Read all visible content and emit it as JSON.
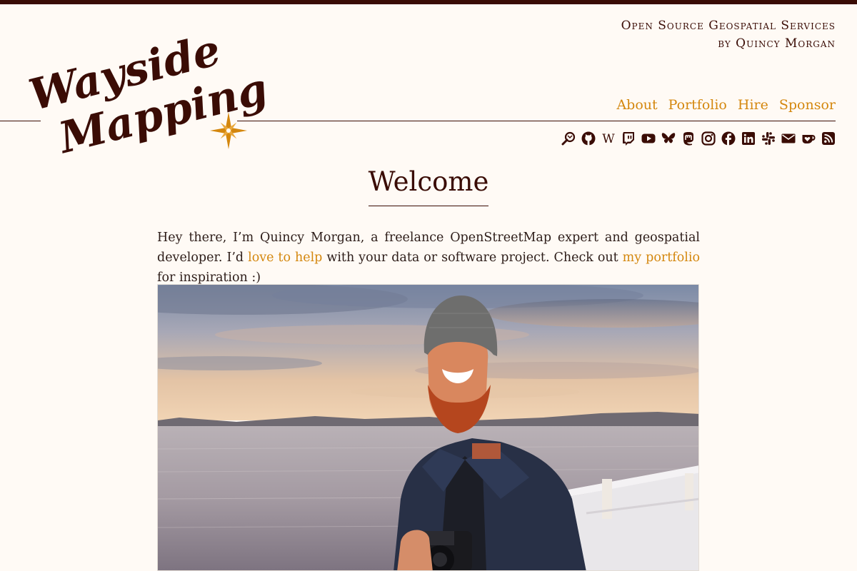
{
  "site": {
    "logo_line1": "Wayside",
    "logo_line2": "Mapping",
    "tagline_line1": "Open Source Geospatial Services",
    "tagline_line2": "by Quincy Morgan"
  },
  "nav": {
    "items": [
      {
        "label": "About"
      },
      {
        "label": "Portfolio"
      },
      {
        "label": "Hire"
      },
      {
        "label": "Sponsor"
      }
    ]
  },
  "social": {
    "icons": [
      "openstreetmap-icon",
      "github-icon",
      "wikipedia-icon",
      "twitch-icon",
      "youtube-icon",
      "bluesky-icon",
      "mastodon-icon",
      "instagram-icon",
      "facebook-icon",
      "linkedin-icon",
      "slack-icon",
      "email-icon",
      "kofi-icon",
      "rss-icon"
    ],
    "wikipedia_glyph": "W"
  },
  "main": {
    "title": "Welcome",
    "intro_before_link1": "Hey there, I’m Quincy Morgan, a freelance OpenStreetMap expert and geospatial developer. I’d ",
    "link1": "love to help",
    "intro_between": " with your data or software project. Check out ",
    "link2": "my portfolio",
    "intro_after": " for inspiration :)"
  },
  "colors": {
    "background": "#fffaf5",
    "brand_dark": "#3a0c05",
    "accent": "#d4870e"
  }
}
